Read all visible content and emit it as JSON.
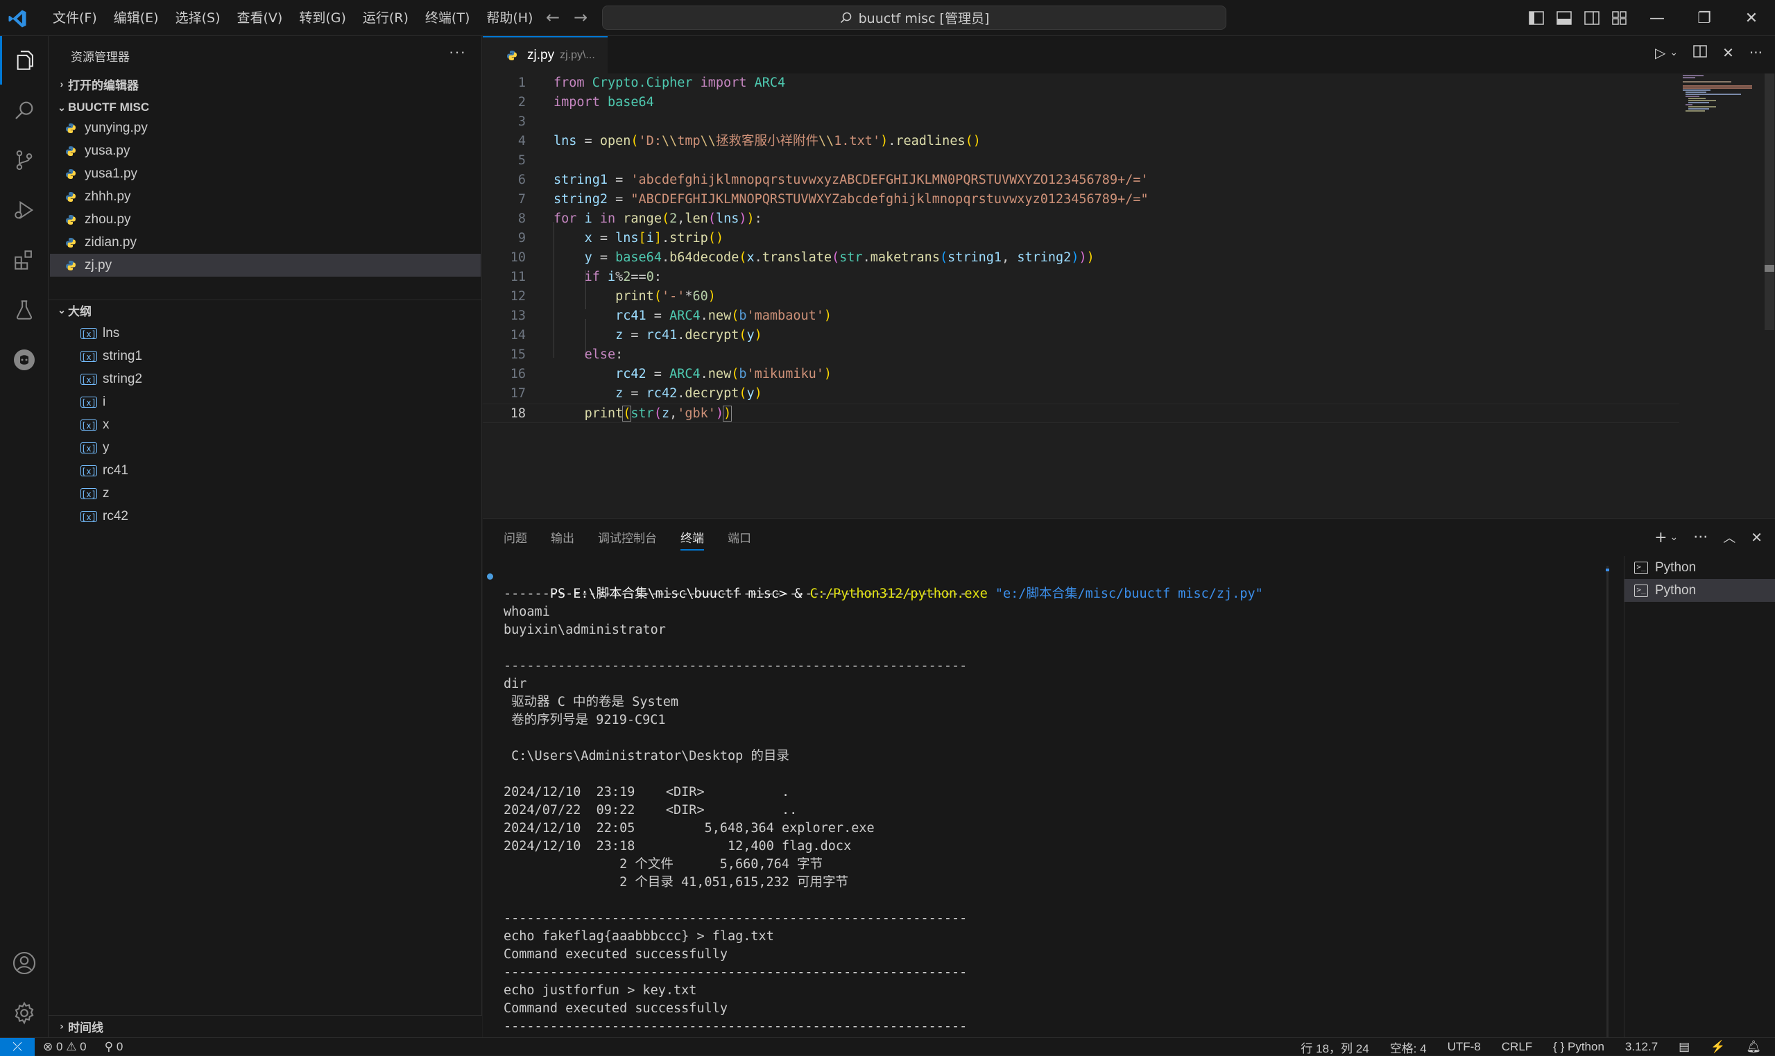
{
  "titlebar": {
    "menu": [
      "文件(F)",
      "编辑(E)",
      "选择(S)",
      "查看(V)",
      "转到(G)",
      "运行(R)",
      "终端(T)",
      "帮助(H)"
    ],
    "search": "buuctf misc [管理员]"
  },
  "sidebar": {
    "title": "资源管理器",
    "open_editors": "打开的编辑器",
    "folder": "BUUCTF MISC",
    "files": [
      "yunying.py",
      "yusa.py",
      "yusa1.py",
      "zhhh.py",
      "zhou.py",
      "zidian.py",
      "zj.py"
    ],
    "selected_file": "zj.py",
    "outline_title": "大纲",
    "outline": [
      "lns",
      "string1",
      "string2",
      "i",
      "x",
      "y",
      "rc41",
      "z",
      "rc42"
    ],
    "timeline": "时间线"
  },
  "editor": {
    "tab_name": "zj.py",
    "tab_desc": "zj.py\\...",
    "current_line": 18
  },
  "panel": {
    "tabs": [
      "问题",
      "输出",
      "调试控制台",
      "终端",
      "端口"
    ],
    "active_tab": "终端",
    "terminals": [
      "Python",
      "Python"
    ],
    "prompt": "PS E:\\脚本合集\\misc\\buuctf misc> & ",
    "exe": "C:/Python312/python.exe",
    "arg": "\"e:/脚本合集/misc/buuctf misc/zj.py\"",
    "output": [
      "------------------------------------------------------------",
      "whoami",
      "buyixin\\administrator",
      "",
      "------------------------------------------------------------",
      "dir",
      " 驱动器 C 中的卷是 System",
      " 卷的序列号是 9219-C9C1",
      "",
      " C:\\Users\\Administrator\\Desktop 的目录",
      "",
      "2024/12/10  23:19    <DIR>          .",
      "2024/07/22  09:22    <DIR>          ..",
      "2024/12/10  22:05         5,648,364 explorer.exe",
      "2024/12/10  23:18            12,400 flag.docx",
      "               2 个文件      5,660,764 字节",
      "               2 个目录 41,051,615,232 可用字节",
      "",
      "------------------------------------------------------------",
      "echo fakeflag{aaabbbccc} > flag.txt",
      "Command executed successfully",
      "------------------------------------------------------------",
      "echo justforfun > key.txt",
      "Command executed successfully",
      "------------------------------------------------------------"
    ]
  },
  "statusbar": {
    "errors": "0",
    "warnings": "0",
    "ports": "0",
    "position": "行 18，列 24",
    "spaces": "空格: 4",
    "encoding": "UTF-8",
    "eol": "CRLF",
    "language": "{ } Python",
    "version": "3.12.7"
  },
  "colors": {
    "accent": "#0078d4",
    "background": "#1f1f1f",
    "sidebar": "#181818",
    "selection": "#37373d"
  },
  "icons": [
    "explorer-icon",
    "search-icon",
    "source-control-icon",
    "run-debug-icon",
    "extensions-icon",
    "testing-icon",
    "github-icon",
    "account-icon",
    "settings-icon"
  ]
}
